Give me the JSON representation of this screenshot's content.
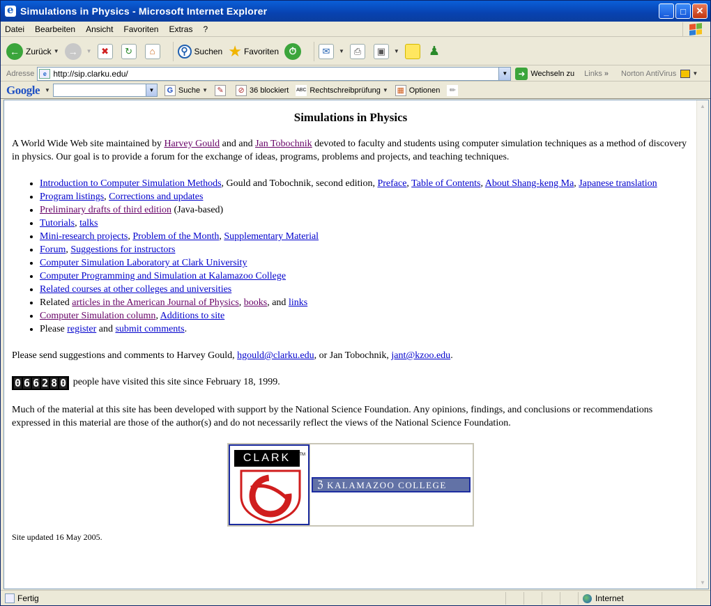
{
  "window": {
    "title": "Simulations in Physics - Microsoft Internet Explorer",
    "minimize": "_",
    "maximize": "□",
    "close": "✕"
  },
  "menu": [
    "Datei",
    "Bearbeiten",
    "Ansicht",
    "Favoriten",
    "Extras",
    "?"
  ],
  "toolbar": {
    "back": "Zurück",
    "search": "Suchen",
    "favorites": "Favoriten"
  },
  "address": {
    "label": "Adresse",
    "url": "http://sip.clarku.edu/",
    "go": "Wechseln zu",
    "links": "Links",
    "links_more": "»",
    "norton": "Norton AntiVirus"
  },
  "googlebar": {
    "logo": "Google",
    "search": "Suche",
    "blocked": "36 blockiert",
    "spell": "Rechtschreibprüfung",
    "options": "Optionen"
  },
  "page": {
    "title": "Simulations in Physics",
    "intro": {
      "t1": "A World Wide Web site maintained by ",
      "harvey": "Harvey Gould",
      "t2": " and and ",
      "jan": "Jan Tobochnik",
      "t3": " devoted to faculty and students using computer simulation techniques as a method of discovery in physics. Our goal is to provide a forum for the exchange of ideas, programs, problems and projects, and teaching techniques."
    },
    "items": {
      "i1": {
        "intro_link": "Introduction to Computer Simulation Methods",
        "t1": ", Gould and Tobochnik, second edition, ",
        "preface": "Preface",
        "toc": "Table of Contents",
        "about": "About Shang-keng Ma",
        "japanese": "Japanese translation"
      },
      "i2": {
        "listings": "Program listings",
        "corrections": "Corrections and updates"
      },
      "i3": {
        "drafts": "Preliminary drafts of third edition",
        "t1": " (Java-based)"
      },
      "i4": {
        "tutorials": "Tutorials",
        "talks": "talks"
      },
      "i5": {
        "mini": "Mini-research projects",
        "potm": "Problem of the Month",
        "supp": "Supplementary Material"
      },
      "i6": {
        "forum": "Forum",
        "suggestions": "Suggestions for instructors"
      },
      "i7": {
        "clarklab": "Computer Simulation Laboratory at Clark University"
      },
      "i8": {
        "kalamazoo": "Computer Programming and Simulation at Kalamazoo College"
      },
      "i9": {
        "related": "Related courses at other colleges and universities"
      },
      "i10": {
        "t1": "Related ",
        "ajp": "articles in the American Journal of Physics",
        "books": "books",
        "t2": ", and ",
        "links": "links"
      },
      "i11": {
        "column": "Computer Simulation column",
        "additions": "Additions to site"
      },
      "i12": {
        "t1": "Please ",
        "register": "register",
        "t2": " and ",
        "submit": "submit comments",
        "t3": "."
      }
    },
    "contact": {
      "t1": "Please send suggestions and comments to Harvey Gould, ",
      "hgould": "hgould@clarku.edu",
      "t2": ", or Jan Tobochnik, ",
      "jant": "jant@kzoo.edu",
      "t3": "."
    },
    "counter": [
      "0",
      "6",
      "6",
      "2",
      "8",
      "0"
    ],
    "visitors": " people have visited this site since February 18, 1999.",
    "nsf": "Much of the material at this site has been developed with support by the National Science Foundation. Any opinions, findings, and conclusions or recommendations expressed in this material are those of the author(s) and do not necessarily reflect the views of the National Science Foundation.",
    "clark_logo": "CLARK",
    "clark_tm": "TM",
    "kalamazoo_logo": "KALAMAZOO COLLEGE",
    "updated": "Site updated 16 May 2005."
  },
  "status": {
    "text": "Fertig",
    "zone": "Internet"
  },
  "colors": {
    "link": "#0000CC",
    "visited": "#660066",
    "titlebar": "#0842B0"
  }
}
